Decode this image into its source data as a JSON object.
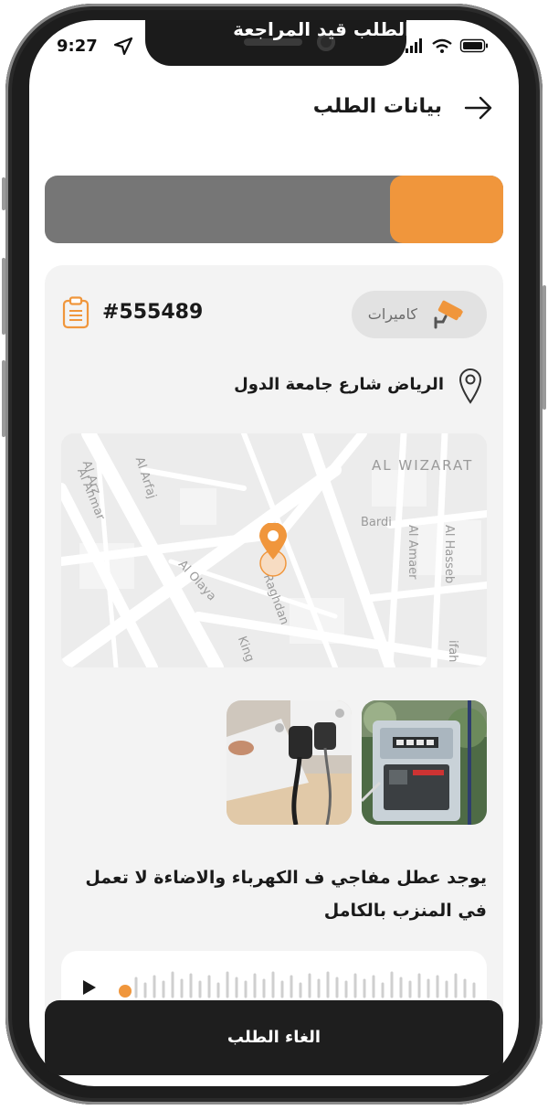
{
  "status_bar": {
    "time": "9:27"
  },
  "header": {
    "title": "بيانات الطلب"
  },
  "order_status": {
    "text": "الطلب قيد المراجعة",
    "accent_color": "#f0963c",
    "bar_color": "#767676"
  },
  "order": {
    "category": "كاميرات",
    "number": "#555489",
    "address": "الرياض شارع جامعة الدول",
    "description": "يوجد عطل مفاجي ف الكهرباء والاضاءة لا تعمل في المنزب بالكامل"
  },
  "map": {
    "labels": [
      "AL WIZARAT",
      "Al Arz",
      "Al Arfaj",
      "Al Ahmar",
      "Bardi",
      "Al Amaer",
      "Al Hasseb",
      "Al Olaya",
      "Raghdan",
      "King",
      "ifah"
    ]
  },
  "photos": [
    {
      "name": "electric-meter-photo"
    },
    {
      "name": "power-plug-photo"
    }
  ],
  "actions": {
    "cancel_label": "الغاء الطلب"
  }
}
